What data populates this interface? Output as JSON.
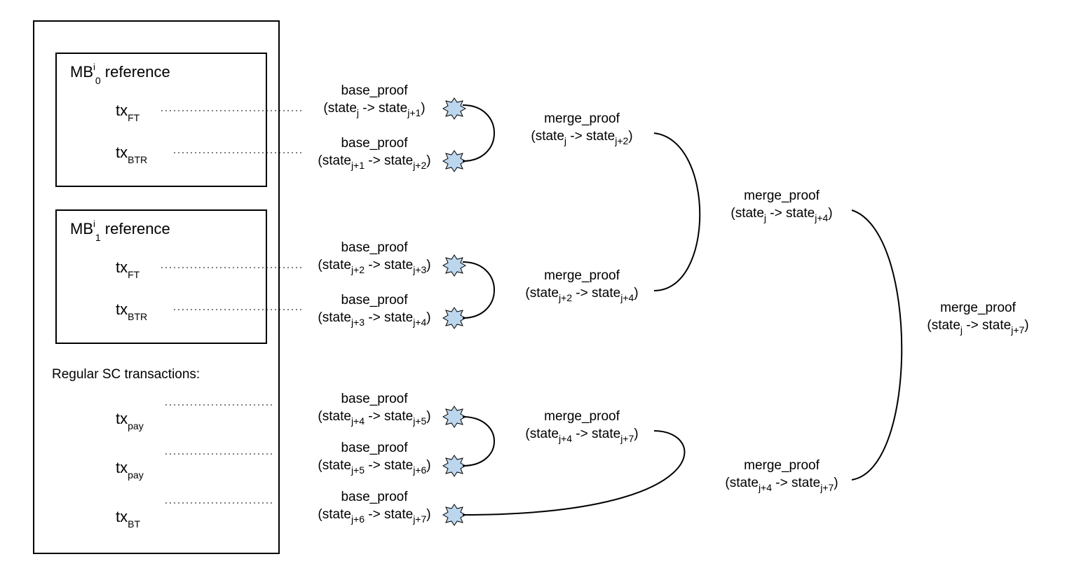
{
  "outer_box": true,
  "boxes": [
    {
      "title_prefix": "MB",
      "title_super": "i",
      "title_sub": "0",
      "title_suffix": " reference",
      "tx": [
        {
          "prefix": "tx",
          "sub": "FT"
        },
        {
          "prefix": "tx",
          "sub": "BTR"
        }
      ]
    },
    {
      "title_prefix": "MB",
      "title_super": "i",
      "title_sub": "1",
      "title_suffix": " reference",
      "tx": [
        {
          "prefix": "tx",
          "sub": "FT"
        },
        {
          "prefix": "tx",
          "sub": "BTR"
        }
      ]
    }
  ],
  "regular_label": "Regular SC transactions:",
  "regular_tx": [
    {
      "prefix": "tx",
      "sub": "pay"
    },
    {
      "prefix": "tx",
      "sub": "pay"
    },
    {
      "prefix": "tx",
      "sub": "BT"
    }
  ],
  "base_proofs": [
    {
      "label": "base_proof",
      "from": "j",
      "to": "j+1"
    },
    {
      "label": "base_proof",
      "from": "j+1",
      "to": "j+2"
    },
    {
      "label": "base_proof",
      "from": "j+2",
      "to": "j+3"
    },
    {
      "label": "base_proof",
      "from": "j+3",
      "to": "j+4"
    },
    {
      "label": "base_proof",
      "from": "j+4",
      "to": "j+5"
    },
    {
      "label": "base_proof",
      "from": "j+5",
      "to": "j+6"
    },
    {
      "label": "base_proof",
      "from": "j+6",
      "to": "j+7"
    }
  ],
  "merge_proofs": [
    {
      "label": "merge_proof",
      "from": "j",
      "to": "j+2"
    },
    {
      "label": "merge_proof",
      "from": "j+2",
      "to": "j+4"
    },
    {
      "label": "merge_proof",
      "from": "j+4",
      "to": "j+7"
    },
    {
      "label": "merge_proof",
      "from": "j",
      "to": "j+4"
    },
    {
      "label": "merge_proof",
      "from": "j+4",
      "to": "j+7"
    },
    {
      "label": "merge_proof",
      "from": "j",
      "to": "j+7"
    }
  ]
}
